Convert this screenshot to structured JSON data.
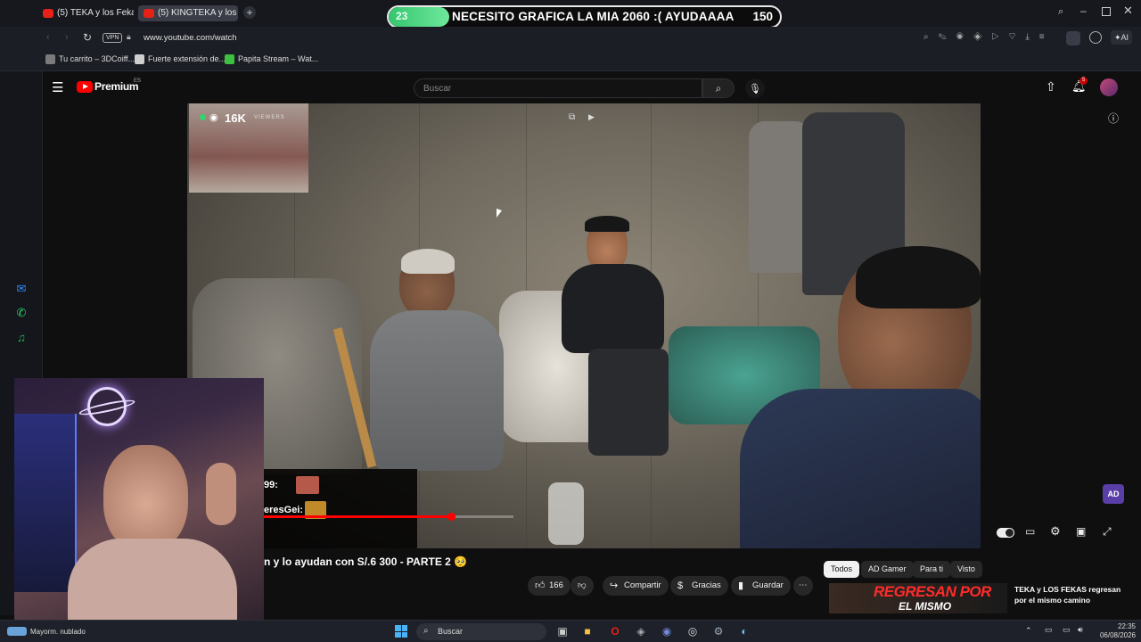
{
  "browser": {
    "tabs": [
      {
        "label": "(5) TEKA y los Fekas van p"
      },
      {
        "label": "(5) KINGTEKA y los FE"
      }
    ],
    "address": {
      "vpn_badge": "VPN",
      "url": "www.youtube.com/watch"
    },
    "bookmarks": [
      {
        "label": "Tu carrito – 3DCoiff...",
        "color": "#7a7a7a"
      },
      {
        "label": "Fuerte extensión de...",
        "color": "#9a9a9a"
      },
      {
        "label": "Papita Stream – Wat...",
        "color": "#3fbf3f"
      }
    ],
    "ai_label": "AI"
  },
  "stream_goal": {
    "current": "23",
    "target": "150",
    "progress": 0.15,
    "message": "NECESITO GRAFICA LA MIA 2060 :( AYUDAAAA"
  },
  "youtube": {
    "logo_text": "Premium",
    "region": "ES",
    "search_placeholder": "Buscar",
    "notifications_count": "5",
    "video": {
      "viewers": "16K",
      "viewers_label": "VIEWERS",
      "title_partial": "n y lo ayudan con S/.6 300 - PARTE 2 🥺",
      "progress": 0.75
    },
    "chat_overlay": [
      {
        "name": "99:"
      },
      {
        "name": "eresGei:"
      }
    ],
    "actions": {
      "likes": "166",
      "share": "Compartir",
      "thanks": "Gracias",
      "save": "Guardar"
    },
    "chips": [
      "Todos",
      "AD Gamer",
      "Para ti",
      "Visto"
    ],
    "recommendation": {
      "thumb_text_1": "REGRESAN POR",
      "thumb_text_2": "EL MISMO",
      "title_line1": "TEKA y LOS FEKAS regresan",
      "title_line2": "por el mismo camino"
    },
    "ad_badge": "AD"
  },
  "taskbar": {
    "weather": "Mayorm. nublado",
    "search": "Buscar",
    "time": "22:35",
    "date": "06/08/2026"
  },
  "colors": {
    "yt_red": "#ff0000",
    "goal_green": "#35c56f",
    "opera_red": "#e62117"
  }
}
